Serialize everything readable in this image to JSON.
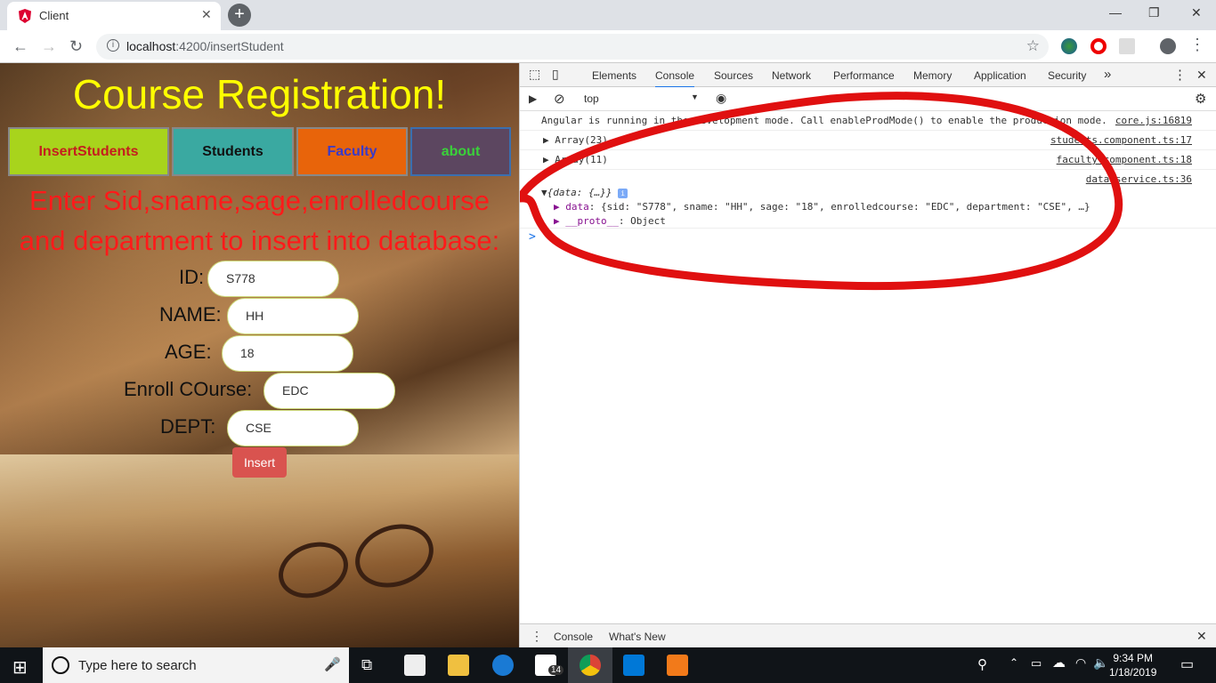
{
  "browser": {
    "tab_title": "Client",
    "url_host": "localhost",
    "url_rest": ":4200/insertStudent"
  },
  "page": {
    "title": "Course Registration!",
    "nav": [
      {
        "label": "InsertStudents",
        "bg": "#a8d41c",
        "fg": "#c41e1e"
      },
      {
        "label": "Students",
        "bg": "#3aa9a1",
        "fg": "#111111"
      },
      {
        "label": "Faculty",
        "bg": "#e8640a",
        "fg": "#3a3ac8"
      },
      {
        "label": "about",
        "bg": "#5c4660",
        "fg": "#3ad13a"
      }
    ],
    "instruction_line1": "Enter Sid,sname,sage,enrolledcourse",
    "instruction_line2": "and department to insert into database:",
    "fields": {
      "id": {
        "label": "ID:",
        "value": "S778"
      },
      "name": {
        "label": "NAME:",
        "value": "HH"
      },
      "age": {
        "label": "AGE:",
        "value": "18"
      },
      "course": {
        "label": "Enroll COurse:",
        "value": "EDC"
      },
      "dept": {
        "label": "DEPT:",
        "value": "CSE"
      }
    },
    "insert_label": "Insert"
  },
  "devtools": {
    "tabs": [
      "Elements",
      "Console",
      "Sources",
      "Network",
      "Performance",
      "Memory",
      "Application",
      "Security"
    ],
    "more": "»",
    "context": "top",
    "console": [
      {
        "text": "Angular is running in the development mode. Call enableProdMode() to enable the production mode.",
        "src": "core.js:16819"
      },
      {
        "text": "▶ Array(23)",
        "src": "students.component.ts:17"
      },
      {
        "text": "▶ Array(11)",
        "src": "faculty.component.ts:18"
      },
      {
        "text": "",
        "src": "data.service.ts:36"
      }
    ],
    "obj_header": "▼{data: {…}}",
    "obj_info": "i",
    "obj_data_key": "▶ data",
    "obj_data_val": ": {sid: \"S778\", sname: \"HH\", sage: \"18\", enrolledcourse: \"EDC\", department: \"CSE\", …}",
    "obj_proto_key": "▶ __proto__",
    "obj_proto_val": ": Object",
    "prompt": ">",
    "drawer_tabs": [
      "Console",
      "What's New"
    ]
  },
  "taskbar": {
    "search_placeholder": "Type here to search",
    "time": "9:34 PM",
    "date": "1/18/2019",
    "mail_badge": "14"
  },
  "annotation_color": "#e01010"
}
